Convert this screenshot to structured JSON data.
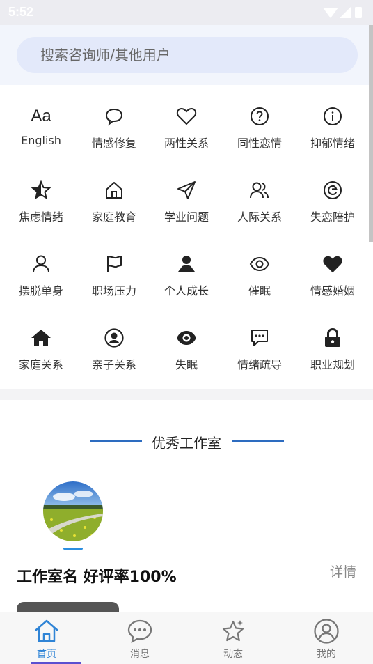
{
  "status": {
    "time": "5:52"
  },
  "search": {
    "placeholder": "搜索咨询师/其他用户"
  },
  "categories": [
    {
      "label": "English",
      "icon": "aa-text-icon"
    },
    {
      "label": "情感修复",
      "icon": "chat-bubble-icon"
    },
    {
      "label": "两性关系",
      "icon": "heart-outline-icon"
    },
    {
      "label": "同性恋情",
      "icon": "question-circle-icon"
    },
    {
      "label": "抑郁情绪",
      "icon": "info-circle-icon"
    },
    {
      "label": "焦虑情绪",
      "icon": "half-star-icon"
    },
    {
      "label": "家庭教育",
      "icon": "home-outline-icon"
    },
    {
      "label": "学业问题",
      "icon": "send-icon"
    },
    {
      "label": "人际关系",
      "icon": "users-icon"
    },
    {
      "label": "失恋陪护",
      "icon": "refresh-circle-icon"
    },
    {
      "label": "摆脱单身",
      "icon": "user-outline-icon"
    },
    {
      "label": "职场压力",
      "icon": "flag-icon"
    },
    {
      "label": "个人成长",
      "icon": "person-filled-icon"
    },
    {
      "label": "催眠",
      "icon": "eye-outline-icon"
    },
    {
      "label": "情感婚姻",
      "icon": "heart-filled-icon"
    },
    {
      "label": "家庭关系",
      "icon": "home-filled-icon"
    },
    {
      "label": "亲子关系",
      "icon": "user-circle-icon"
    },
    {
      "label": "失眠",
      "icon": "eye-filled-icon"
    },
    {
      "label": "情绪疏导",
      "icon": "chat-dots-icon"
    },
    {
      "label": "职业规划",
      "icon": "lock-icon"
    }
  ],
  "section": {
    "title": "优秀工作室"
  },
  "studio": {
    "name": "工作室名 好评率100%",
    "detail_label": "详情"
  },
  "tabs": [
    {
      "label": "首页",
      "active": true
    },
    {
      "label": "消息",
      "active": false
    },
    {
      "label": "动态",
      "active": false
    },
    {
      "label": "我的",
      "active": false
    }
  ],
  "colors": {
    "accent": "#2f84d6",
    "rule": "#2d6cc0",
    "search_bg": "#e3e9fa"
  }
}
